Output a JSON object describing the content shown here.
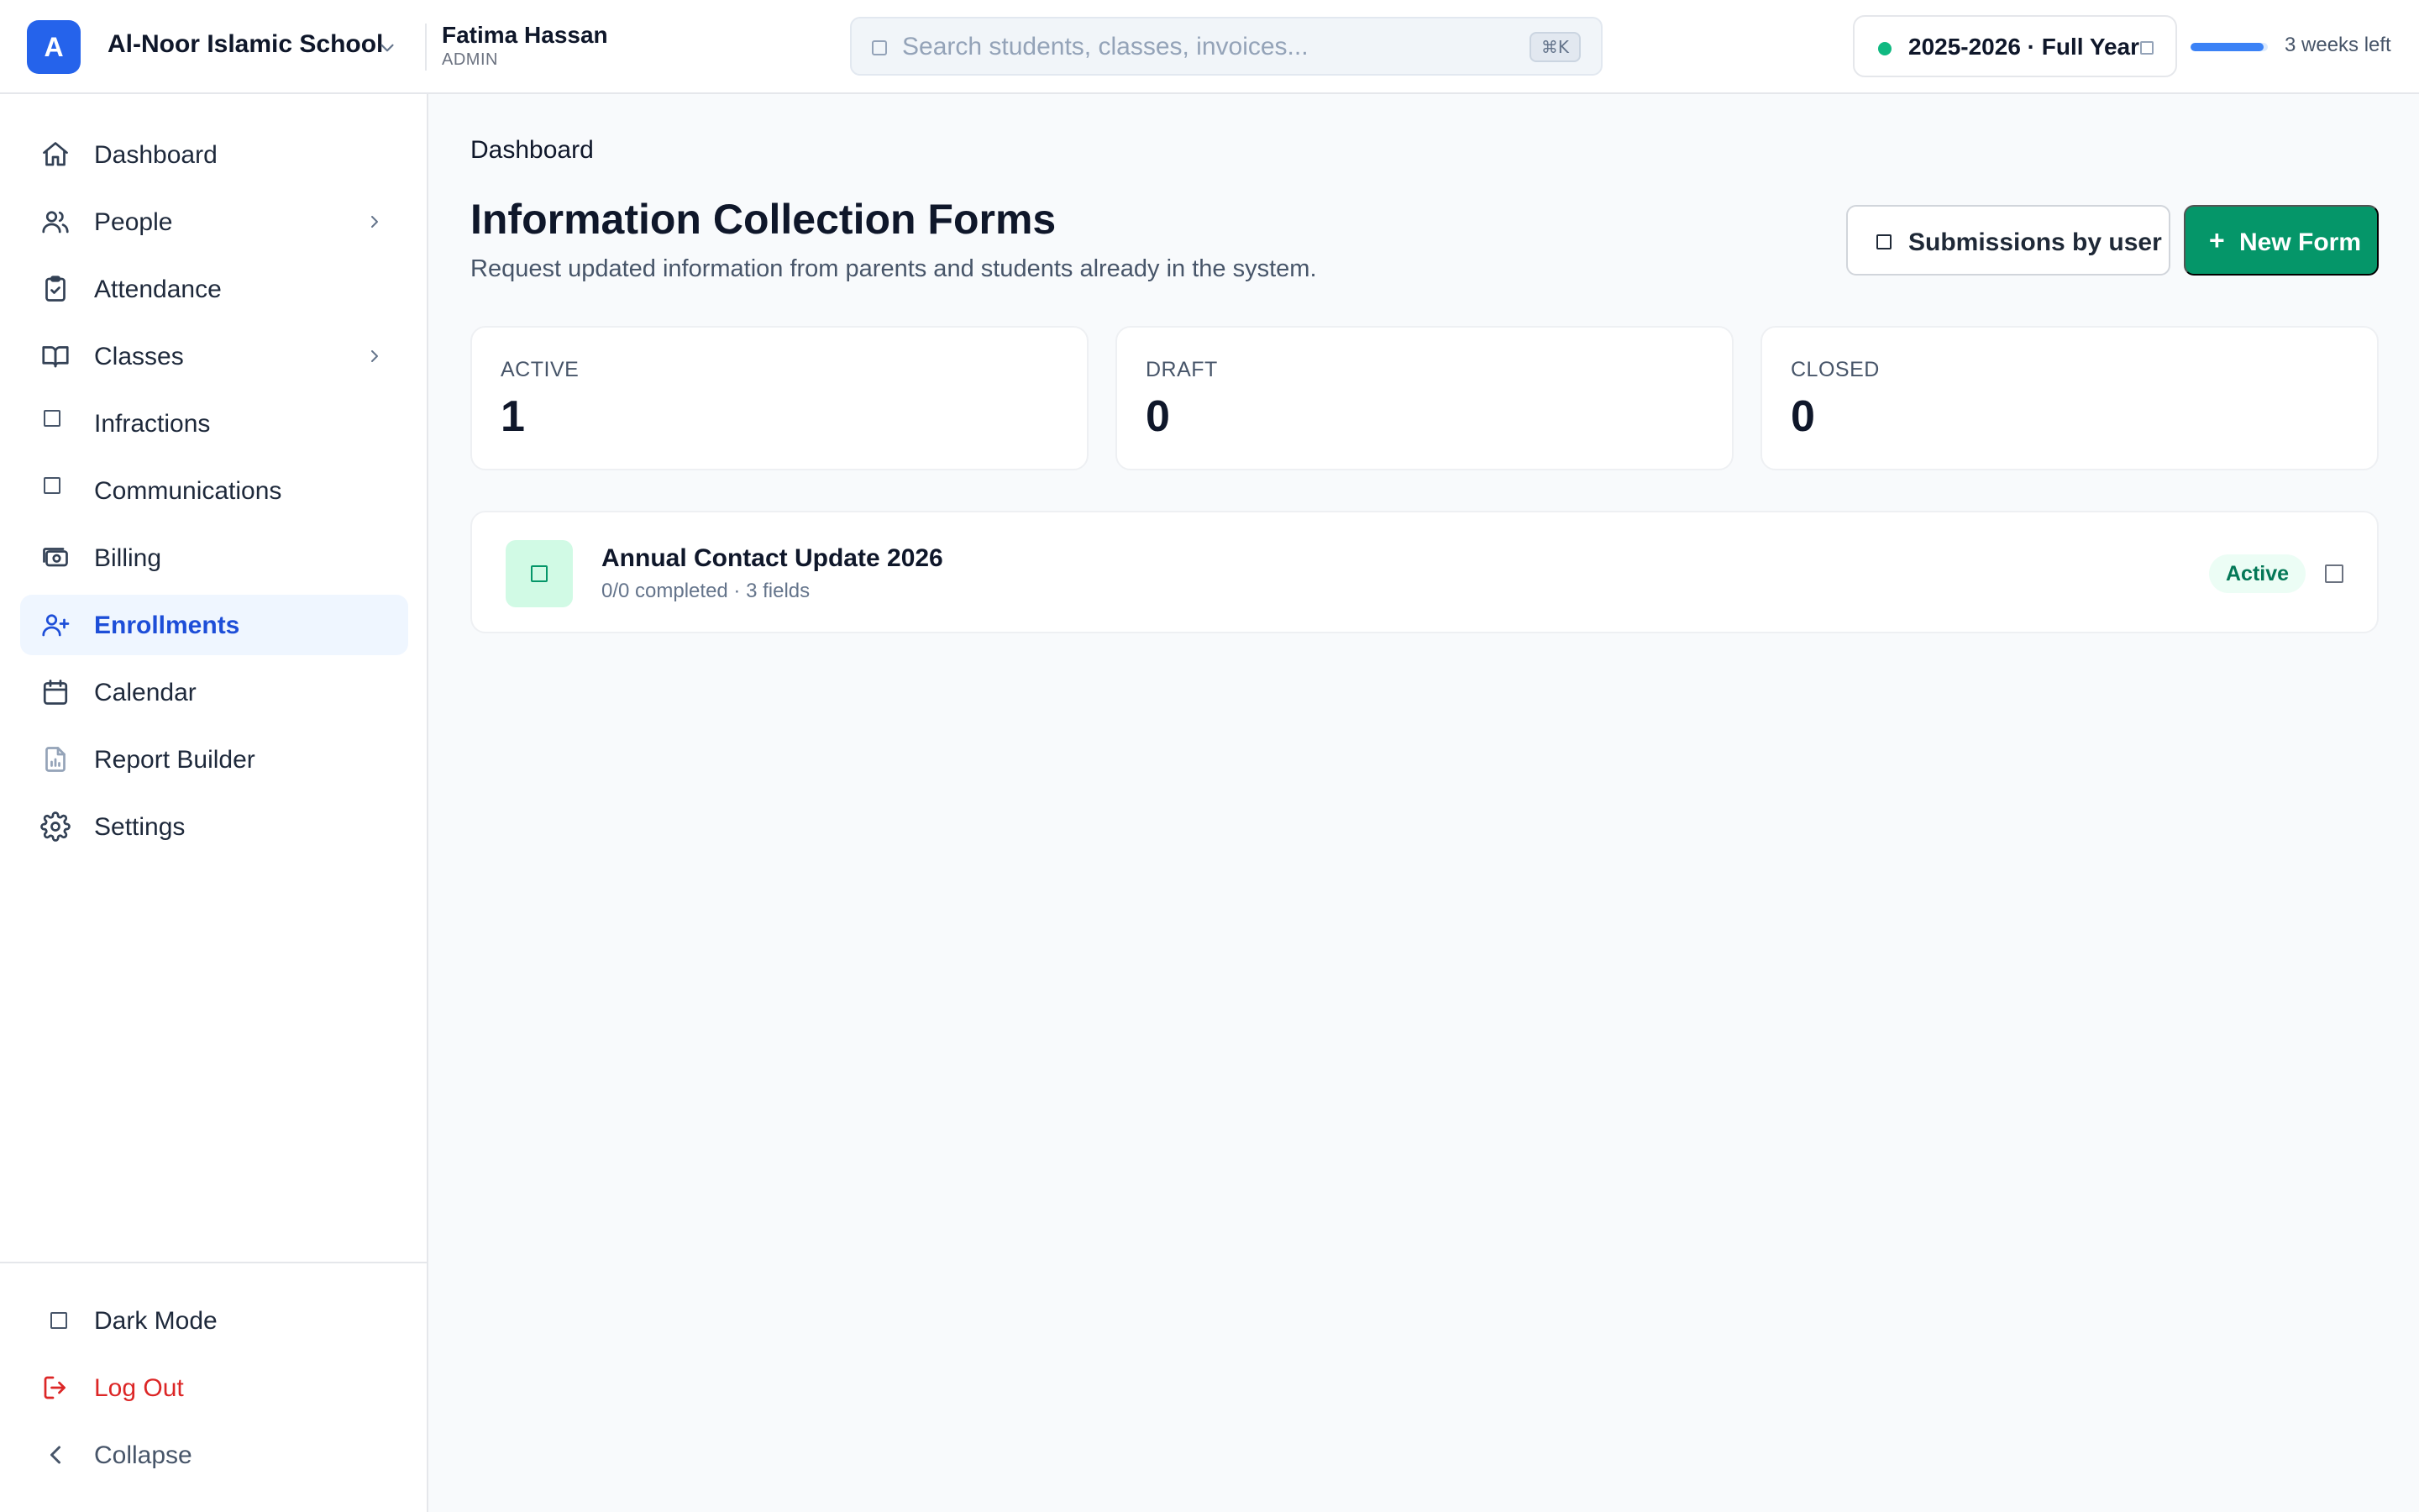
{
  "header": {
    "logo_letter": "A",
    "school_name": "Al-Noor Islamic School",
    "user_name": "Fatima Hassan",
    "user_role": "ADMIN",
    "search_placeholder": "Search students, classes, invoices...",
    "search_shortcut": "⌘K",
    "year_label": "2025-2026 · Full Year",
    "term_progress_percent": 95,
    "weeks_left": "3 weeks left",
    "accent_color": "#2563eb"
  },
  "sidebar": {
    "items": [
      {
        "label": "Dashboard",
        "icon": "home-icon"
      },
      {
        "label": "People",
        "icon": "users-icon",
        "has_chevron": true
      },
      {
        "label": "Attendance",
        "icon": "clipboard-check-icon"
      },
      {
        "label": "Classes",
        "icon": "book-open-icon",
        "has_chevron": true
      },
      {
        "label": "Infractions",
        "icon": "square-icon"
      },
      {
        "label": "Communications",
        "icon": "square-icon"
      },
      {
        "label": "Billing",
        "icon": "money-icon"
      },
      {
        "label": "Enrollments",
        "icon": "user-plus-icon",
        "active": true
      },
      {
        "label": "Calendar",
        "icon": "calendar-icon"
      },
      {
        "label": "Report Builder",
        "icon": "report-file-icon"
      },
      {
        "label": "Settings",
        "icon": "gear-icon"
      }
    ],
    "bottom": {
      "dark_mode": "Dark Mode",
      "log_out": "Log Out",
      "collapse": "Collapse"
    }
  },
  "main": {
    "breadcrumb": "Dashboard",
    "title": "Information Collection Forms",
    "subtitle": "Request updated information from parents and students already in the system.",
    "submissions_button": "Submissions by user",
    "new_form_button": "New Form",
    "stats": [
      {
        "label": "ACTIVE",
        "value": "1"
      },
      {
        "label": "DRAFT",
        "value": "0"
      },
      {
        "label": "CLOSED",
        "value": "0"
      }
    ],
    "forms": [
      {
        "title": "Annual Contact Update 2026",
        "meta": "0/0 completed · 3 fields",
        "status": "Active"
      }
    ],
    "primary_color": "#059669"
  }
}
